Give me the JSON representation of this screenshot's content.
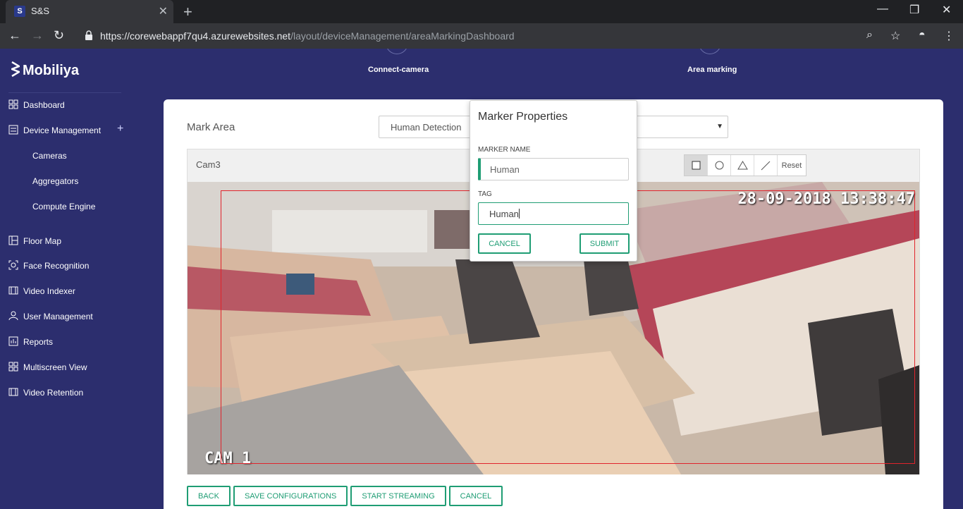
{
  "browser": {
    "tab_title": "S&S",
    "url_host": "https://corewebappf7qu4.azurewebsites.net",
    "url_path": "/layout/deviceManagement/areaMarkingDashboard"
  },
  "app": {
    "brand": "Mobiliya",
    "nav": [
      {
        "label": "Dashboard",
        "icon": "grid-icon"
      },
      {
        "label": "Device Management",
        "icon": "list-icon"
      },
      {
        "label": "Cameras"
      },
      {
        "label": "Aggregators"
      },
      {
        "label": "Compute Engine"
      },
      {
        "label": "Floor Map",
        "icon": "floor-map-icon"
      },
      {
        "label": "Face Recognition",
        "icon": "face-scan-icon"
      },
      {
        "label": "Video Indexer",
        "icon": "film-icon"
      },
      {
        "label": "User Management",
        "icon": "user-icon"
      },
      {
        "label": "Reports",
        "icon": "chart-icon"
      },
      {
        "label": "Multiscreen View",
        "icon": "grid-icon"
      },
      {
        "label": "Video Retention",
        "icon": "film-icon"
      }
    ]
  },
  "steps": {
    "connect": "Connect-camera",
    "area": "Area marking"
  },
  "card": {
    "title": "Mark Area",
    "detection_select": "Human Detection",
    "camera_name": "Cam3",
    "reset_label": "Reset",
    "timestamp": "28-09-2018 13:38:47",
    "cam_overlay": "CAM 1",
    "buttons": {
      "back": "BACK",
      "save": "SAVE CONFIGURATIONS",
      "start": "START STREAMING",
      "cancel": "CANCEL"
    }
  },
  "modal": {
    "title": "Marker Properties",
    "marker_name_label": "MARKER NAME",
    "marker_name_value": "Human",
    "tag_label": "TAG",
    "tag_value": "Human",
    "cancel": "CANCEL",
    "submit": "SUBMIT"
  },
  "colors": {
    "sidebar_bg": "#2c2e6e",
    "accent_green": "#1f9d74",
    "roi_red": "#e0242c"
  }
}
